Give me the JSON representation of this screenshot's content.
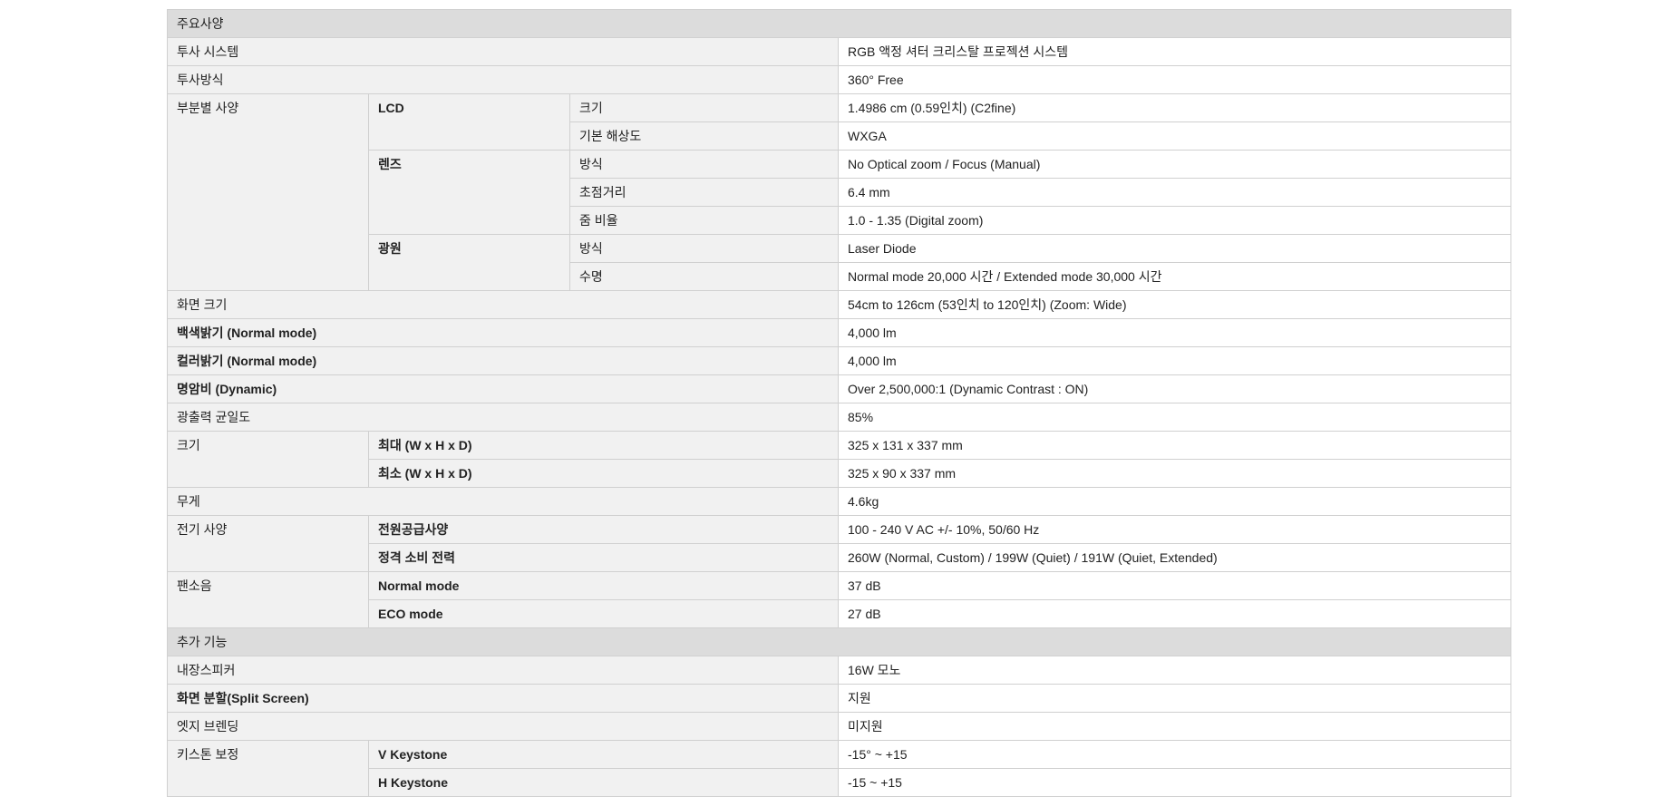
{
  "sections": [
    {
      "title": "주요사양",
      "rows": [
        {
          "label": "투사 시스템",
          "value": "RGB 액정 셔터 크리스탈 프로젝션 시스템"
        },
        {
          "label": "투사방식",
          "value": "360° Free"
        },
        {
          "label": "부분별 사양",
          "groups": [
            {
              "name": "LCD",
              "items": [
                {
                  "label": "크기",
                  "value": "1.4986 cm (0.59인치) (C2fine)"
                },
                {
                  "label": "기본 해상도",
                  "value": "WXGA"
                }
              ]
            },
            {
              "name": "렌즈",
              "items": [
                {
                  "label": "방식",
                  "value": "No Optical zoom / Focus (Manual)"
                },
                {
                  "label": "초점거리",
                  "value": "6.4 mm"
                },
                {
                  "label": "줌 비율",
                  "value": "1.0 - 1.35 (Digital zoom)"
                }
              ]
            },
            {
              "name": "광원",
              "items": [
                {
                  "label": "방식",
                  "value": "Laser Diode"
                },
                {
                  "label": "수명",
                  "value": "Normal mode 20,000 시간 / Extended mode 30,000 시간"
                }
              ]
            }
          ]
        },
        {
          "label": "화면 크기",
          "value": "54cm to 126cm (53인치 to 120인치) (Zoom: Wide)"
        },
        {
          "label_kr": "백색밝기",
          "label_en": "(Normal mode)",
          "value": "4,000 lm"
        },
        {
          "label_kr": "컬러밝기",
          "label_en": "(Normal mode)",
          "value": "4,000 lm"
        },
        {
          "label_kr": "명암비",
          "label_en": "(Dynamic)",
          "value": "Over 2,500,000:1 (Dynamic Contrast : ON)"
        },
        {
          "label": "광출력 균일도",
          "value": "85%"
        },
        {
          "label": "크기",
          "items": [
            {
              "label_kr": "최대",
              "label_en": "(W x H x D)",
              "value": "325 x 131 x 337 mm"
            },
            {
              "label_kr": "최소",
              "label_en": "(W x H x D)",
              "value": "325 x 90 x 337 mm"
            }
          ]
        },
        {
          "label": "무게",
          "value": "4.6kg"
        },
        {
          "label": "전기 사양",
          "items": [
            {
              "label": "전원공급사양",
              "value": "100 - 240 V AC +/- 10%, 50/60 Hz"
            },
            {
              "label": "정격 소비 전력",
              "value": "260W (Normal, Custom) / 199W (Quiet) / 191W (Quiet, Extended)"
            }
          ]
        },
        {
          "label": "팬소음",
          "items": [
            {
              "label": "Normal mode",
              "value": "37 dB"
            },
            {
              "label": "ECO mode",
              "value": "27 dB"
            }
          ]
        }
      ]
    },
    {
      "title": "추가 기능",
      "rows": [
        {
          "label": "내장스피커",
          "value": "16W 모노"
        },
        {
          "label_kr": "화면 분할",
          "label_en": "(Split Screen)",
          "value": "지원"
        },
        {
          "label": "엣지 브렌딩",
          "value": "미지원"
        },
        {
          "label": "키스톤 보정",
          "items": [
            {
              "label": "V Keystone",
              "value": "-15° ~ +15"
            },
            {
              "label": "H Keystone",
              "value": "-15 ~ +15"
            }
          ]
        }
      ]
    }
  ]
}
